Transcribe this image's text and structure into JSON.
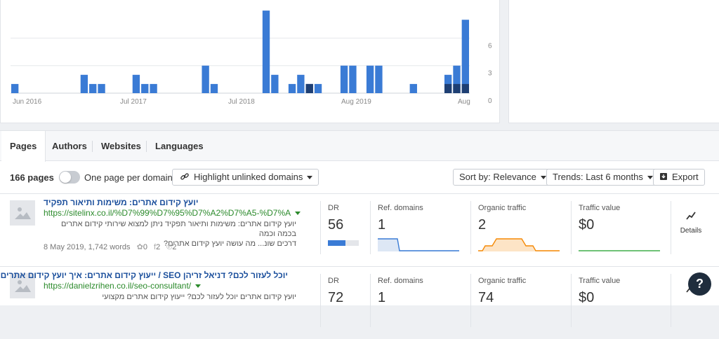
{
  "chart_data": {
    "type": "bar",
    "title": "",
    "xlabel": "",
    "ylabel": "",
    "ylim": [
      0,
      9
    ],
    "yticks": [
      "0",
      "3",
      "6"
    ],
    "xtick_labels": [
      "Jun 2016",
      "Jul 2017",
      "Jul 2018",
      "Aug 2019",
      "Aug"
    ],
    "x_start": "Jun 2016",
    "x_end": "Aug",
    "colors": {
      "light": "#3a7bd5",
      "dark": "#1e3f73"
    },
    "series": [
      {
        "values": [
          1,
          0,
          0,
          0,
          0,
          0,
          0,
          0,
          2,
          1,
          1,
          0,
          0,
          0,
          2,
          1,
          1,
          0,
          0,
          0,
          0,
          0,
          3,
          1,
          0,
          0,
          0,
          0,
          0,
          9,
          2,
          0,
          1,
          2,
          1,
          1,
          0,
          0,
          3,
          3,
          0,
          3,
          3,
          0,
          0,
          0,
          1,
          0,
          0,
          0,
          2,
          3,
          8
        ]
      },
      {
        "values": [
          0,
          0,
          0,
          0,
          0,
          0,
          0,
          0,
          0,
          0,
          0,
          0,
          0,
          0,
          0,
          0,
          0,
          0,
          0,
          0,
          0,
          0,
          0,
          0,
          0,
          0,
          0,
          0,
          0,
          0,
          0,
          0,
          0,
          0,
          1,
          0,
          0,
          0,
          0,
          0,
          0,
          0,
          0,
          0,
          0,
          0,
          0,
          0,
          0,
          0,
          1,
          1,
          1
        ]
      }
    ]
  },
  "tabs": [
    "Pages",
    "Authors",
    "Websites",
    "Languages"
  ],
  "toolbar": {
    "count": "166 pages",
    "toggle_label": "One page per domain",
    "highlight_label": "Highlight unlinked domains",
    "sort_label": "Sort by: Relevance",
    "trends_label": "Trends: Last 6 months",
    "export_label": "Export"
  },
  "rows": [
    {
      "title": "יועץ קידום אתרים: משימות ותיאור תפקיד",
      "url": "https://sitelinx.co.il/%D7%99%D7%95%D7%A2%D7%A5-%D7%A",
      "snippet_1": "יועץ קידום אתרים: משימות ותיאור תפקיד ניתן למצוא שירותי קידום אתרים בכמה וכמה",
      "snippet_2": "דרכים שונ... מה עושה יועץ קידום אתרים?",
      "date": "8 May 2019",
      "words": "1,742 words",
      "twitter": "0",
      "facebook": "2",
      "pinterest": "2",
      "dr": "56",
      "dr_fraction": 0.56,
      "ref_domains": "1",
      "organic_traffic": "2",
      "traffic_value": "$0",
      "details": "Details"
    },
    {
      "title": "יוכל לעזור לכם? דניאל זריהן SEO / ייעוץ קידום אתרים: איך יועץ קידום אתרים",
      "url": "https://danielzrihen.co.il/seo-consultant/",
      "snippet_1": "יועץ קידום אתרים יוכל לעזור לכם? ייעוץ קידום אתרים מקצועי",
      "snippet_2": "",
      "dr": "72",
      "ref_domains": "1",
      "organic_traffic": "74",
      "traffic_value": "$0"
    }
  ],
  "metric_labels": {
    "dr": "DR",
    "ref_domains": "Ref. domains",
    "organic_traffic": "Organic traffic",
    "traffic_value": "Traffic value"
  },
  "help": "?"
}
